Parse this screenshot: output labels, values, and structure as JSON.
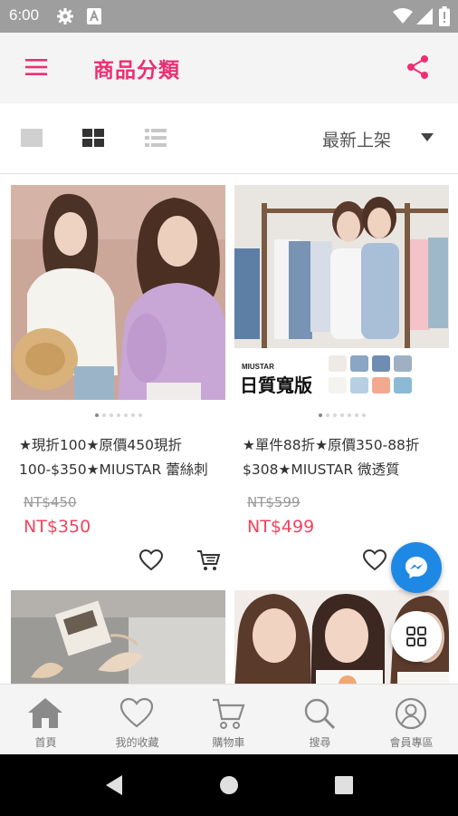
{
  "status_bar": {
    "time": "6:00",
    "icons": [
      "gear-icon",
      "a-icon",
      "wifi-icon",
      "signal-icon",
      "battery-icon"
    ]
  },
  "app_bar": {
    "title": "商品分類",
    "menu_icon": "menu-icon",
    "share_icon": "share-icon"
  },
  "toolbar": {
    "views": [
      "single-view-icon",
      "grid-view-icon",
      "list-view-icon"
    ],
    "sort_label": "最新上架",
    "sort_icon": "dropdown-arrow-icon"
  },
  "products": [
    {
      "name": "★現折100★原價450現折100-$350★MIUSTAR 蕾絲刺",
      "old_price": "NT$450",
      "price": "NT$350"
    },
    {
      "name": "★單件88折★原價350-88折$308★MIUSTAR 微透質",
      "old_price": "NT$599",
      "price": "NT$499",
      "banner_brand": "MIUSTAR",
      "banner_text": "日質寬版"
    },
    {
      "name": "",
      "old_price": "",
      "price": ""
    },
    {
      "name": "",
      "old_price": "",
      "price": ""
    }
  ],
  "fabs": {
    "messenger": "messenger-icon",
    "category": "category-grid-icon"
  },
  "bottom_nav": [
    {
      "label": "首頁",
      "icon": "home-icon"
    },
    {
      "label": "我的收藏",
      "icon": "heart-icon"
    },
    {
      "label": "購物車",
      "icon": "cart-icon"
    },
    {
      "label": "搜尋",
      "icon": "search-icon"
    },
    {
      "label": "會員專區",
      "icon": "user-icon"
    }
  ],
  "colors": {
    "accent": "#ec2f72",
    "price": "#f0445e",
    "messenger": "#1e88e5"
  }
}
